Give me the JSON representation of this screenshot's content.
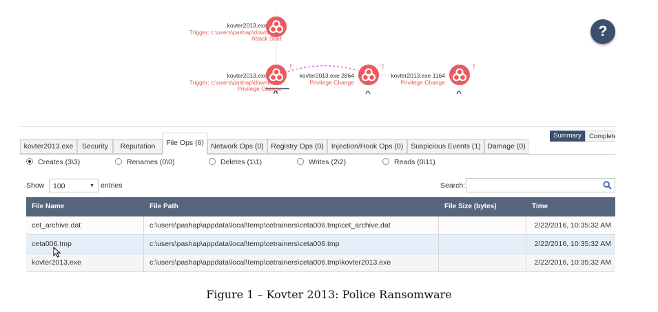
{
  "graph": {
    "nodes": [
      {
        "process": "kovter2013.exe 2256",
        "trigger": "Trigger: c:\\users\\pashap\\downloads",
        "event": "Attack Start"
      },
      {
        "process": "kovter2013.exe 1628",
        "trigger": "Trigger: c:\\users\\pashap\\downloads",
        "event": "Privilege Change"
      },
      {
        "process": "kovter2013.exe 2864",
        "event": "Privilege Change"
      },
      {
        "process": "kovter2013.exe 1164",
        "event": "Privilege Change"
      }
    ],
    "help_label": "?",
    "node_color": "#ec5a5f"
  },
  "tabs": [
    {
      "label": "kovter2013.exe"
    },
    {
      "label": "Security"
    },
    {
      "label": "Reputation"
    },
    {
      "label": "File Ops (6)"
    },
    {
      "label": "Network Ops (0)"
    },
    {
      "label": "Registry Ops (0)"
    },
    {
      "label": "Injection/Hook Ops (0)"
    },
    {
      "label": "Suspicious Events (1)"
    },
    {
      "label": "Damage (0)"
    }
  ],
  "active_tab": "File Ops (6)",
  "view_toggle": {
    "summary": "Summary",
    "complete": "Complete"
  },
  "filters": [
    {
      "label": "Creates (3\\3)",
      "checked": true
    },
    {
      "label": "Renames (0\\0)",
      "checked": false
    },
    {
      "label": "Deletes (1\\1)",
      "checked": false
    },
    {
      "label": "Writes (2\\2)",
      "checked": false
    },
    {
      "label": "Reads (0\\11)",
      "checked": false
    }
  ],
  "show": {
    "label": "Show",
    "value": "100",
    "suffix": "entries"
  },
  "search": {
    "label": "Search:",
    "value": ""
  },
  "table": {
    "columns": [
      "File Name",
      "File Path",
      "File Size (bytes)",
      "Time"
    ],
    "rows": [
      {
        "name": "cet_archive.dat",
        "path": "c:\\users\\pashap\\appdata\\local\\temp\\cetrainers\\ceta006.tmp\\cet_archive.dat",
        "size": "",
        "time": "2/22/2016, 10:35:32 AM"
      },
      {
        "name": "ceta006.tmp",
        "path": "c:\\users\\pashap\\appdata\\local\\temp\\cetrainers\\ceta006.tmp",
        "size": "",
        "time": "2/22/2016, 10:35:32 AM"
      },
      {
        "name": "kovter2013.exe",
        "path": "c:\\users\\pashap\\appdata\\local\\temp\\cetrainers\\ceta006.tmp\\kovter2013.exe",
        "size": "",
        "time": "2/22/2016, 10:35:32 AM"
      }
    ]
  },
  "caption": "Figure 1 – Kovter 2013: Police Ransomware",
  "colors": {
    "header_bg": "#56657d",
    "accent": "#3c4f6e",
    "selected_row": "#e6eefa"
  }
}
